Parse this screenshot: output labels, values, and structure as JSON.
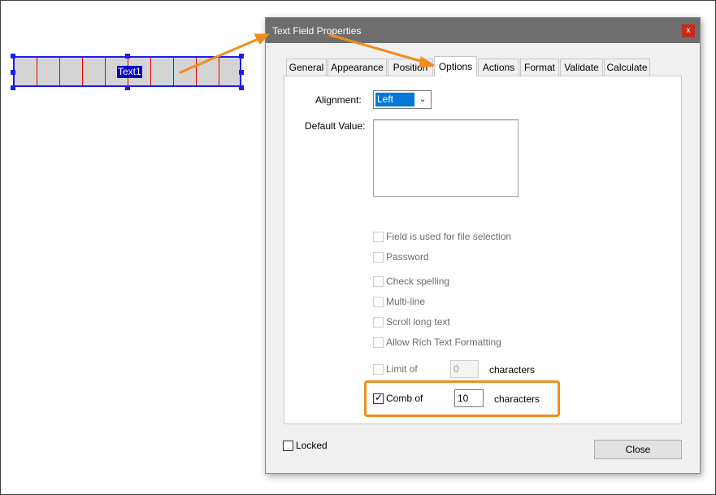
{
  "canvas": {
    "field_name": "Text1",
    "comb_divisions": 10
  },
  "dialog": {
    "title": "Text Field Properties",
    "close_symbol": "x",
    "tabs": [
      {
        "label": "General",
        "active": false
      },
      {
        "label": "Appearance",
        "active": false
      },
      {
        "label": "Position",
        "active": false
      },
      {
        "label": "Options",
        "active": true
      },
      {
        "label": "Actions",
        "active": false
      },
      {
        "label": "Format",
        "active": false
      },
      {
        "label": "Validate",
        "active": false
      },
      {
        "label": "Calculate",
        "active": false
      }
    ],
    "options": {
      "alignment_label": "Alignment:",
      "alignment_value": "Left",
      "default_value_label": "Default Value:",
      "default_value": "",
      "file_selection": {
        "label": "Field is used for file selection",
        "checked": false,
        "enabled": false
      },
      "password": {
        "label": "Password",
        "checked": false,
        "enabled": false
      },
      "check_spelling": {
        "label": "Check spelling",
        "checked": false,
        "enabled": false
      },
      "multi_line": {
        "label": "Multi-line",
        "checked": false,
        "enabled": false
      },
      "scroll_long_text": {
        "label": "Scroll long text",
        "checked": false,
        "enabled": false
      },
      "rich_text": {
        "label": "Allow Rich Text Formatting",
        "checked": false,
        "enabled": false
      },
      "limit_of": {
        "label": "Limit of",
        "value": "0",
        "suffix": "characters",
        "checked": false,
        "enabled": false
      },
      "comb_of": {
        "label": "Comb of",
        "value": "10",
        "suffix": "characters",
        "checked": true,
        "enabled": true
      }
    },
    "locked": {
      "label": "Locked",
      "checked": false
    },
    "close_button": "Close"
  },
  "colors": {
    "annotation_arrow": "#f08c1e",
    "selection_blue": "#1c1cf0",
    "comb_divider_red": "#e00000",
    "titlebar": "#6e6e6e"
  }
}
